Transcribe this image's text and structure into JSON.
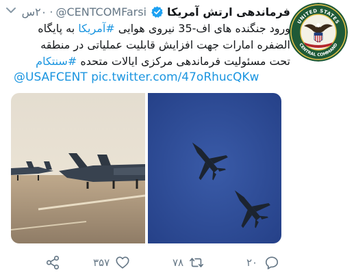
{
  "header": {
    "display_name": "فرماندهی ارتش آمریکا",
    "handle": "@CENTCOMFarsi",
    "separator": "·",
    "time": "۲۰س"
  },
  "tweet": {
    "text_before_hashtag1": "ورود جنگنده های اف-35 نیروی هوایی ",
    "hashtag1": "#آمریکا",
    "text_middle": " به پایگاه الضفره امارات جهت افزایش قابلیت عملیاتی در منطقه تحت مسئولیت فرماندهی مرکزی ایالات متحده ",
    "hashtag2": "#سنتکام",
    "link_line": "@USAFCENT pic.twitter.com/47oRhucQKw"
  },
  "avatar": {
    "ring_top_text": "UNITED STATES",
    "ring_bottom_text": "CENTRAL COMMAND"
  },
  "actions": {
    "like_count": "۳۵۷",
    "retweet_count": "۷۸",
    "reply_count": "۲۰"
  },
  "colors": {
    "link": "#1b95e0",
    "muted": "#657786",
    "verified": "#1da1f2",
    "sky_left": "#e9e1d2",
    "sky_right": "#2f4e9c",
    "avatar_green": "#1f5a37",
    "avatar_red": "#b3262c"
  }
}
